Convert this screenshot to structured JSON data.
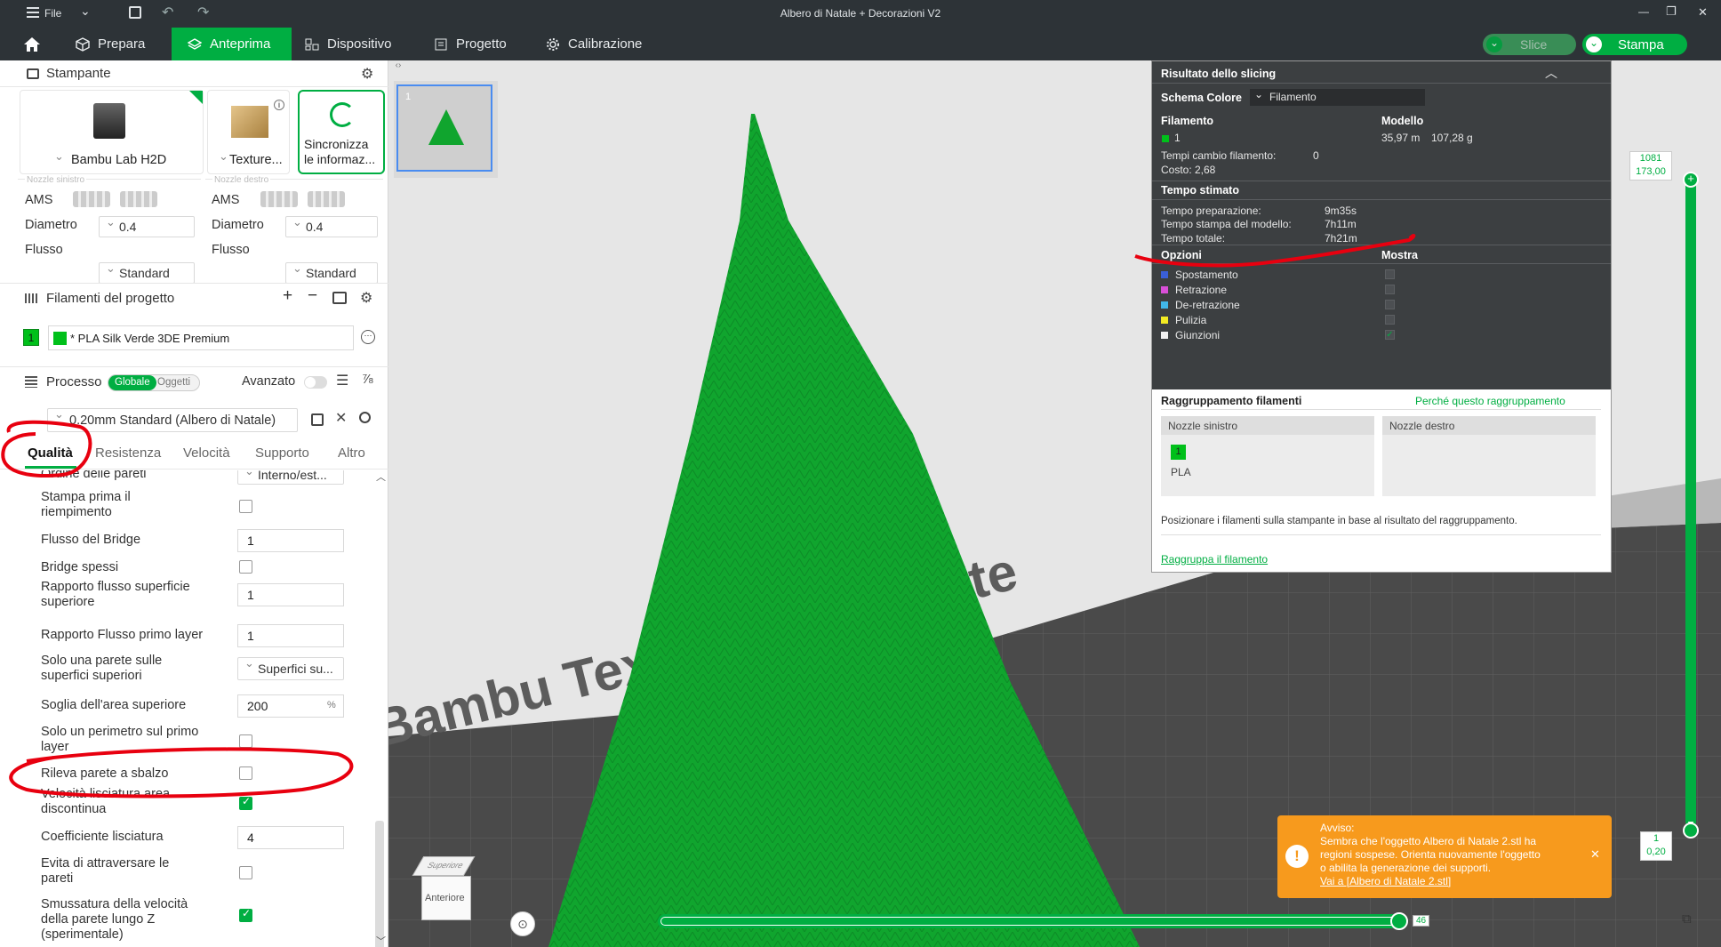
{
  "window": {
    "menu_label": "File",
    "title": "Albero di Natale + Decorazioni V2",
    "min": "—",
    "max": "❐",
    "close": "✕"
  },
  "nav": {
    "items": [
      "Prepara",
      "Anteprima",
      "Dispositivo",
      "Progetto",
      "Calibrazione"
    ],
    "active": "Anteprima",
    "slice_label": "Slice",
    "print_label": "Stampa"
  },
  "printer": {
    "section_title": "Stampante",
    "printer_name": "Bambu Lab H2D",
    "plate_name": "Texture...",
    "sync_label_1": "Sincronizza",
    "sync_label_2": "le informaz...",
    "left_nozzle": {
      "caption": "Nozzle sinistro",
      "ams_label": "AMS",
      "diameter_label": "Diametro",
      "diameter_value": "0.4",
      "flow_label": "Flusso",
      "flow_value": "Standard"
    },
    "right_nozzle": {
      "caption": "Nozzle destro",
      "ams_label": "AMS",
      "diameter_label": "Diametro",
      "diameter_value": "0.4",
      "flow_label": "Flusso",
      "flow_value": "Standard"
    }
  },
  "filaments": {
    "section_title": "Filamenti del progetto",
    "items": [
      {
        "index": "1",
        "name": "* PLA Silk Verde 3DE Premium",
        "color": "#00c01a"
      }
    ]
  },
  "process": {
    "section_title": "Processo",
    "toggle_global": "Globale",
    "toggle_objects": "Oggetti",
    "advanced_label": "Avanzato",
    "preset": "0.20mm Standard (Albero di Natale)",
    "tabs": [
      "Qualità",
      "Resistenza",
      "Velocità",
      "Supporto",
      "Altro"
    ],
    "active_tab": "Qualità",
    "params": [
      {
        "label": "Ordine delle pareti",
        "type": "select",
        "value": "Interno/est..."
      },
      {
        "label": "Stampa prima il riempimento",
        "type": "check",
        "value": false
      },
      {
        "label": "Flusso del Bridge",
        "type": "input",
        "value": "1"
      },
      {
        "label": "Bridge spessi",
        "type": "check",
        "value": false
      },
      {
        "label": "Rapporto flusso superficie superiore",
        "type": "input",
        "value": "1"
      },
      {
        "label": "Rapporto Flusso primo layer",
        "type": "input",
        "value": "1"
      },
      {
        "label": "Solo una parete sulle superfici superiori",
        "type": "select",
        "value": "Superfici su..."
      },
      {
        "label": "Soglia dell'area superiore",
        "type": "input",
        "value": "200",
        "unit": "%"
      },
      {
        "label": "Solo un perimetro sul primo layer",
        "type": "check",
        "value": false
      },
      {
        "label": "Rileva parete a sbalzo",
        "type": "check",
        "value": false
      },
      {
        "label": "Velocità lisciatura area discontinua",
        "type": "check",
        "value": true
      },
      {
        "label": "Coefficiente lisciatura",
        "type": "input",
        "value": "4"
      },
      {
        "label": "Evita di attraversare le pareti",
        "type": "check",
        "value": false
      },
      {
        "label": "Smussatura della velocità della parete lungo Z (sperimentale)",
        "type": "check",
        "value": true
      }
    ]
  },
  "plate_thumb": {
    "number": "1"
  },
  "slicing": {
    "title": "Risultato dello slicing",
    "color_scheme_label": "Schema Colore",
    "color_scheme_value": "Filamento",
    "filament_header": "Filamento",
    "model_header": "Modello",
    "filament_index": "1",
    "filament_color": "#00c01a",
    "length": "35,97 m",
    "weight": "107,28 g",
    "changes_label": "Tempi cambio filamento:",
    "changes_value": "0",
    "cost_label": "Costo:",
    "cost_value": "2,68",
    "time_header": "Tempo stimato",
    "prep_label": "Tempo preparazione:",
    "prep_value": "9m35s",
    "model_time_label": "Tempo stampa del modello:",
    "model_time_value": "7h11m",
    "total_label": "Tempo totale:",
    "total_value": "7h21m",
    "options_header": "Opzioni",
    "show_header": "Mostra",
    "options": [
      {
        "label": "Spostamento",
        "color": "#3a5fd9",
        "checked": false
      },
      {
        "label": "Retrazione",
        "color": "#d84fd8",
        "checked": false
      },
      {
        "label": "De-retrazione",
        "color": "#41b7e8",
        "checked": false
      },
      {
        "label": "Pulizia",
        "color": "#f2ea23",
        "checked": false
      },
      {
        "label": "Giunzioni",
        "color": "#f0f0f0",
        "checked": true
      }
    ],
    "grouping_title": "Raggruppamento filamenti",
    "grouping_link": "Perché questo raggruppamento",
    "left_nozzle": "Nozzle sinistro",
    "right_nozzle": "Nozzle destro",
    "group_chip": "1",
    "group_material": "PLA",
    "grouping_note": "Posizionare i filamenti sulla stampante in base al risultato del raggruppamento.",
    "regroup_link": "Raggruppa il filamento"
  },
  "layer_slider": {
    "top_layer": "1081",
    "top_height": "173,00",
    "bottom_layer": "1",
    "bottom_height": "0,20"
  },
  "move_slider": {
    "value": "46"
  },
  "warning": {
    "title": "Avviso:",
    "line1": "Sembra che l'oggetto Albero di Natale 2.stl ha",
    "line2": "regioni sospese. Orienta nuovamente l'oggetto",
    "line3": "o abilita la generazione dei supporti.",
    "link": "Vai a [Albero di Natale 2.stl]"
  },
  "viewcube": {
    "top": "Superiore",
    "front": "Anteriore"
  },
  "bed_text": "Bambu Textured PEI Plate",
  "colors": {
    "accent": "#00ae42",
    "dark_bar": "#2d3337",
    "annotation": "#e8000f",
    "model_green": "#10a52e"
  }
}
